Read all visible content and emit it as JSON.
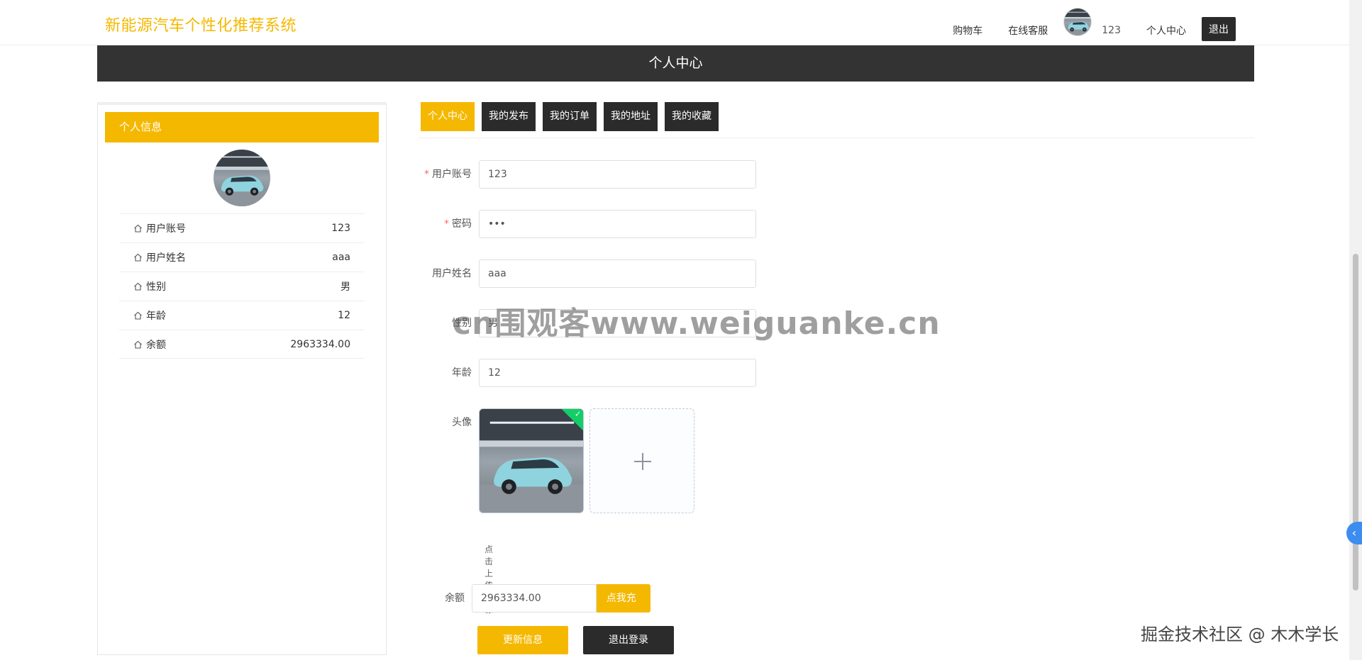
{
  "header": {
    "title": "新能源汽车个性化推荐系统",
    "nav": {
      "cart": "购物车",
      "service": "在线客服",
      "username": "123",
      "profile": "个人中心",
      "logout": "退出"
    }
  },
  "banner": {
    "title": "个人中心"
  },
  "profile_card": {
    "heading": "个人信息",
    "rows": [
      {
        "label": "用户账号",
        "value": "123"
      },
      {
        "label": "用户姓名",
        "value": "aaa"
      },
      {
        "label": "性别",
        "value": "男"
      },
      {
        "label": "年龄",
        "value": "12"
      },
      {
        "label": "余额",
        "value": "2963334.00"
      }
    ]
  },
  "tabs": [
    "个人中心",
    "我的发布",
    "我的订单",
    "我的地址",
    "我的收藏"
  ],
  "form": {
    "account": {
      "label": "用户账号",
      "value": "123"
    },
    "password": {
      "label": "密码",
      "value": "•••"
    },
    "name": {
      "label": "用户姓名",
      "value": "aaa"
    },
    "gender": {
      "label": "性别",
      "value": "男"
    },
    "age": {
      "label": "年龄",
      "value": "12"
    },
    "avatar": {
      "label": "头像",
      "hint": "点击上传头像"
    },
    "balance": {
      "label": "余额",
      "value": "2963334.00",
      "recharge": "点我充值"
    },
    "update_button": "更新信息",
    "logout_button": "退出登录"
  },
  "watermark": "cn围观客www.weiguanke.cn",
  "credit": "掘金技术社区 @ 木木学长",
  "colors": {
    "accent": "#f5b800",
    "dark": "#2b2b2b",
    "success": "#13ce66"
  }
}
